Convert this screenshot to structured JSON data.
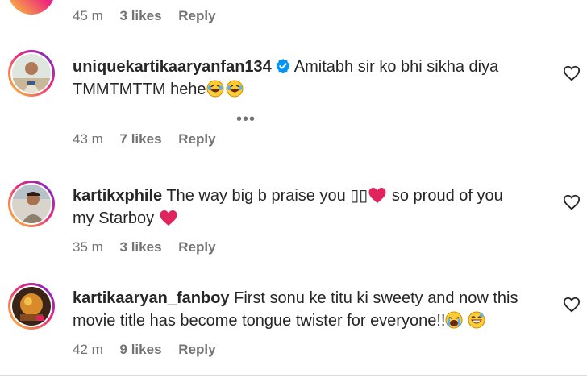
{
  "top_comment": {
    "time": "45 m",
    "likes": "3 likes",
    "reply": "Reply"
  },
  "comments": [
    {
      "username": "uniquekartikaaryanfan134",
      "verified": true,
      "text_line1": "Amitabh sir ko bhi sikha diya",
      "text_line2": "TMMTMTTM hehe",
      "emojis": [
        "rofl-emoji",
        "rofl-emoji"
      ],
      "more": "•••",
      "time": "43 m",
      "likes": "7 likes",
      "reply": "Reply",
      "avatar_icon": "user-avatar-icon"
    },
    {
      "username": "kartikxphile",
      "verified": false,
      "text_line1": "The way big b praise you ▯▯",
      "text_line1_suffix": " so proud of you",
      "text_line2": "my Starboy",
      "emojis": [
        "red-heart-emoji",
        "red-heart-emoji"
      ],
      "time": "35 m",
      "likes": "3 likes",
      "reply": "Reply",
      "avatar_icon": "user-avatar-icon"
    },
    {
      "username": "kartikaaryan_fanboy",
      "verified": false,
      "text_line1": "First sonu ke titu ki sweety and now this",
      "text_line2": "movie title has become tongue twister for everyone!!",
      "emojis": [
        "crying-emoji",
        "grinning-sweat-emoji"
      ],
      "time": "42 m",
      "likes": "9 likes",
      "reply": "Reply",
      "avatar_icon": "user-avatar-icon"
    }
  ],
  "icons": {
    "like": "heart-outline-icon",
    "verified": "verified-badge-icon"
  },
  "colors": {
    "text": "#262626",
    "meta": "#737373",
    "verified": "#0095f6",
    "heart": "#e0245e",
    "story_ring_start": "#f9ce34",
    "story_ring_end": "#6228d7"
  }
}
